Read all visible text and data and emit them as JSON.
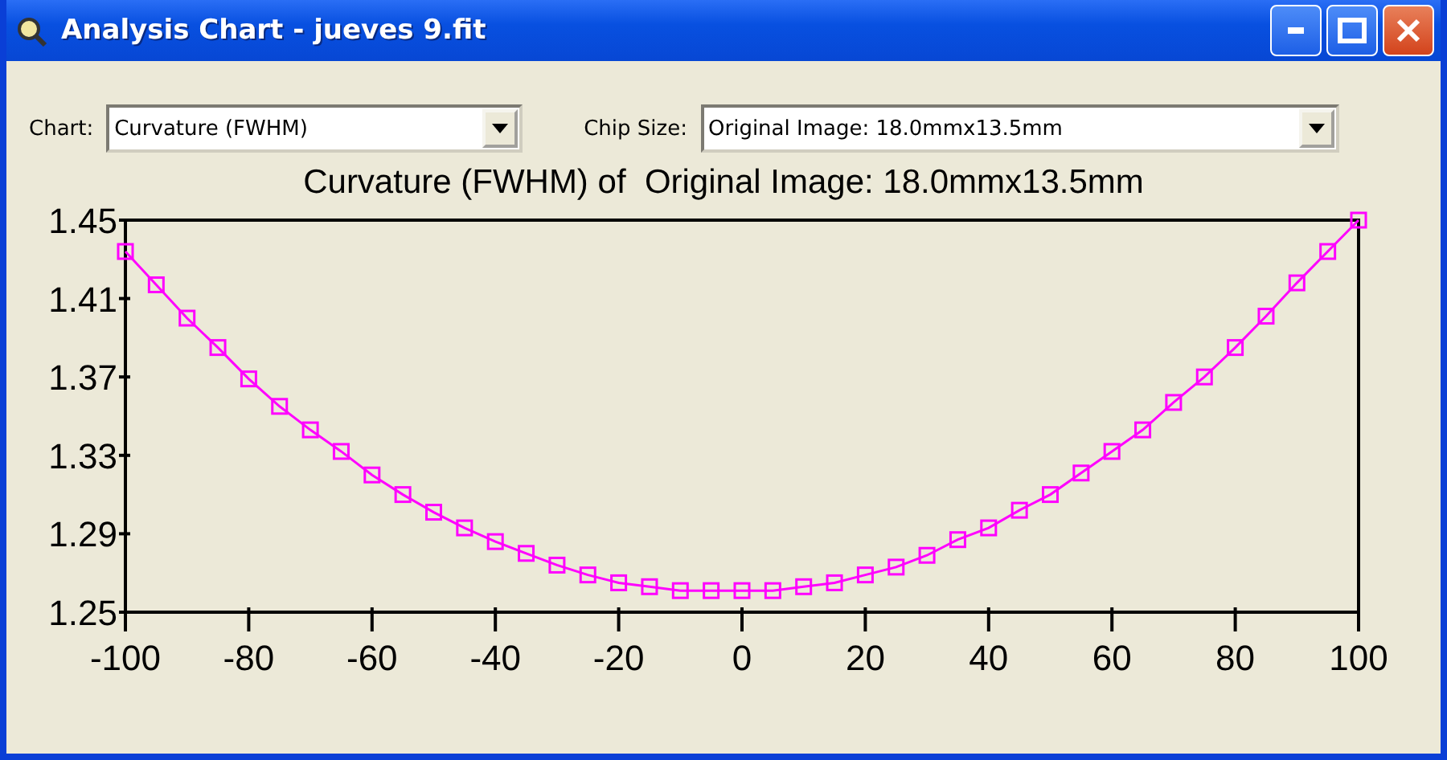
{
  "window": {
    "title": "Analysis Chart - jueves 9.fit"
  },
  "controls": [
    {
      "label": "Chart:",
      "value": "Curvature (FWHM)"
    },
    {
      "label": "Chip Size:",
      "value": "Original Image: 18.0mmx13.5mm"
    }
  ],
  "chart_data": {
    "type": "line",
    "title": "Curvature (FWHM) of  Original Image: 18.0mmx13.5mm",
    "x": [
      -100,
      -95,
      -90,
      -85,
      -80,
      -75,
      -70,
      -65,
      -60,
      -55,
      -50,
      -45,
      -40,
      -35,
      -30,
      -25,
      -20,
      -15,
      -10,
      -5,
      0,
      5,
      10,
      15,
      20,
      25,
      30,
      35,
      40,
      45,
      50,
      55,
      60,
      65,
      70,
      75,
      80,
      85,
      90,
      95,
      100
    ],
    "series": [
      {
        "color": "#ff00ff",
        "marker": "square",
        "values": [
          1.434,
          1.417,
          1.4,
          1.385,
          1.369,
          1.355,
          1.343,
          1.332,
          1.32,
          1.31,
          1.301,
          1.293,
          1.286,
          1.28,
          1.274,
          1.269,
          1.265,
          1.263,
          1.261,
          1.261,
          1.261,
          1.261,
          1.263,
          1.265,
          1.269,
          1.273,
          1.279,
          1.287,
          1.293,
          1.302,
          1.31,
          1.321,
          1.332,
          1.343,
          1.357,
          1.37,
          1.385,
          1.401,
          1.418,
          1.434,
          1.45
        ]
      }
    ],
    "xlim": [
      -100,
      100
    ],
    "ylim": [
      1.25,
      1.45
    ],
    "xticks": [
      -100,
      -80,
      -60,
      -40,
      -20,
      0,
      20,
      40,
      60,
      80,
      100
    ],
    "yticks": [
      1.25,
      1.29,
      1.33,
      1.37,
      1.41,
      1.45
    ]
  }
}
